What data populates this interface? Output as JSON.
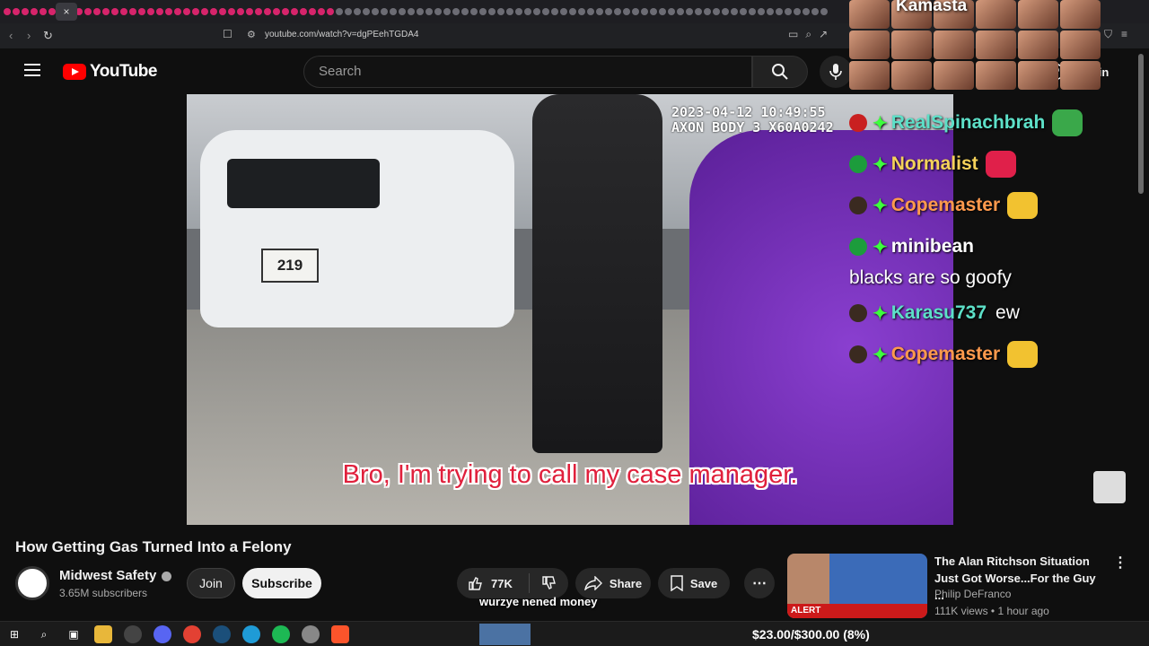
{
  "browser": {
    "url": "youtube.com/watch?v=dgPEehTGDA4",
    "close_tab_glyph": "×"
  },
  "header": {
    "logo_text": "YouTube",
    "search_placeholder": "Search",
    "sign_in_label": "Sign in"
  },
  "video": {
    "timestamp_line1": "2023-04-12 10:49:55",
    "timestamp_line2": "AXON BODY 3 X60A0242",
    "plate_number": "219",
    "caption": "Bro, I'm trying to call my case manager."
  },
  "overlay": {
    "streamer_name": "Kamasta",
    "chat": [
      {
        "user": "RealSpinachbrah",
        "color": "#5de0c8",
        "message": ""
      },
      {
        "user": "Normalist",
        "color": "#f5d25a",
        "message": ""
      },
      {
        "user": "Copemaster",
        "color": "#ff9a4d",
        "message": ""
      },
      {
        "user": "minibean",
        "color": "#ffffff",
        "message": ""
      },
      {
        "user": "Karasu737",
        "color": "#5de0c8",
        "message": "ew"
      },
      {
        "user": "Copemaster",
        "color": "#ff9a4d",
        "message": ""
      }
    ],
    "minibean_body": "blacks are so goofy",
    "lower_caption": "wurzye nened money",
    "goal_text": "$23.00/$300.00 (8%)"
  },
  "info": {
    "title": "How Getting Gas Turned Into a Felony",
    "channel_name": "Midwest Safety",
    "subscribers": "3.65M subscribers",
    "join_label": "Join",
    "subscribe_label": "Subscribe",
    "like_count": "77K",
    "share_label": "Share",
    "save_label": "Save"
  },
  "recommended": {
    "title": "The Alan Ritchson Situation Just Got Worse...For the Guy ...",
    "channel": "Philip DeFranco",
    "meta": "111K views • 1 hour ago",
    "badge": "ALERT"
  },
  "colors": {
    "yt_red": "#ff0000",
    "caption_red": "#e0203c",
    "chat_gem": "#3cff3c"
  }
}
